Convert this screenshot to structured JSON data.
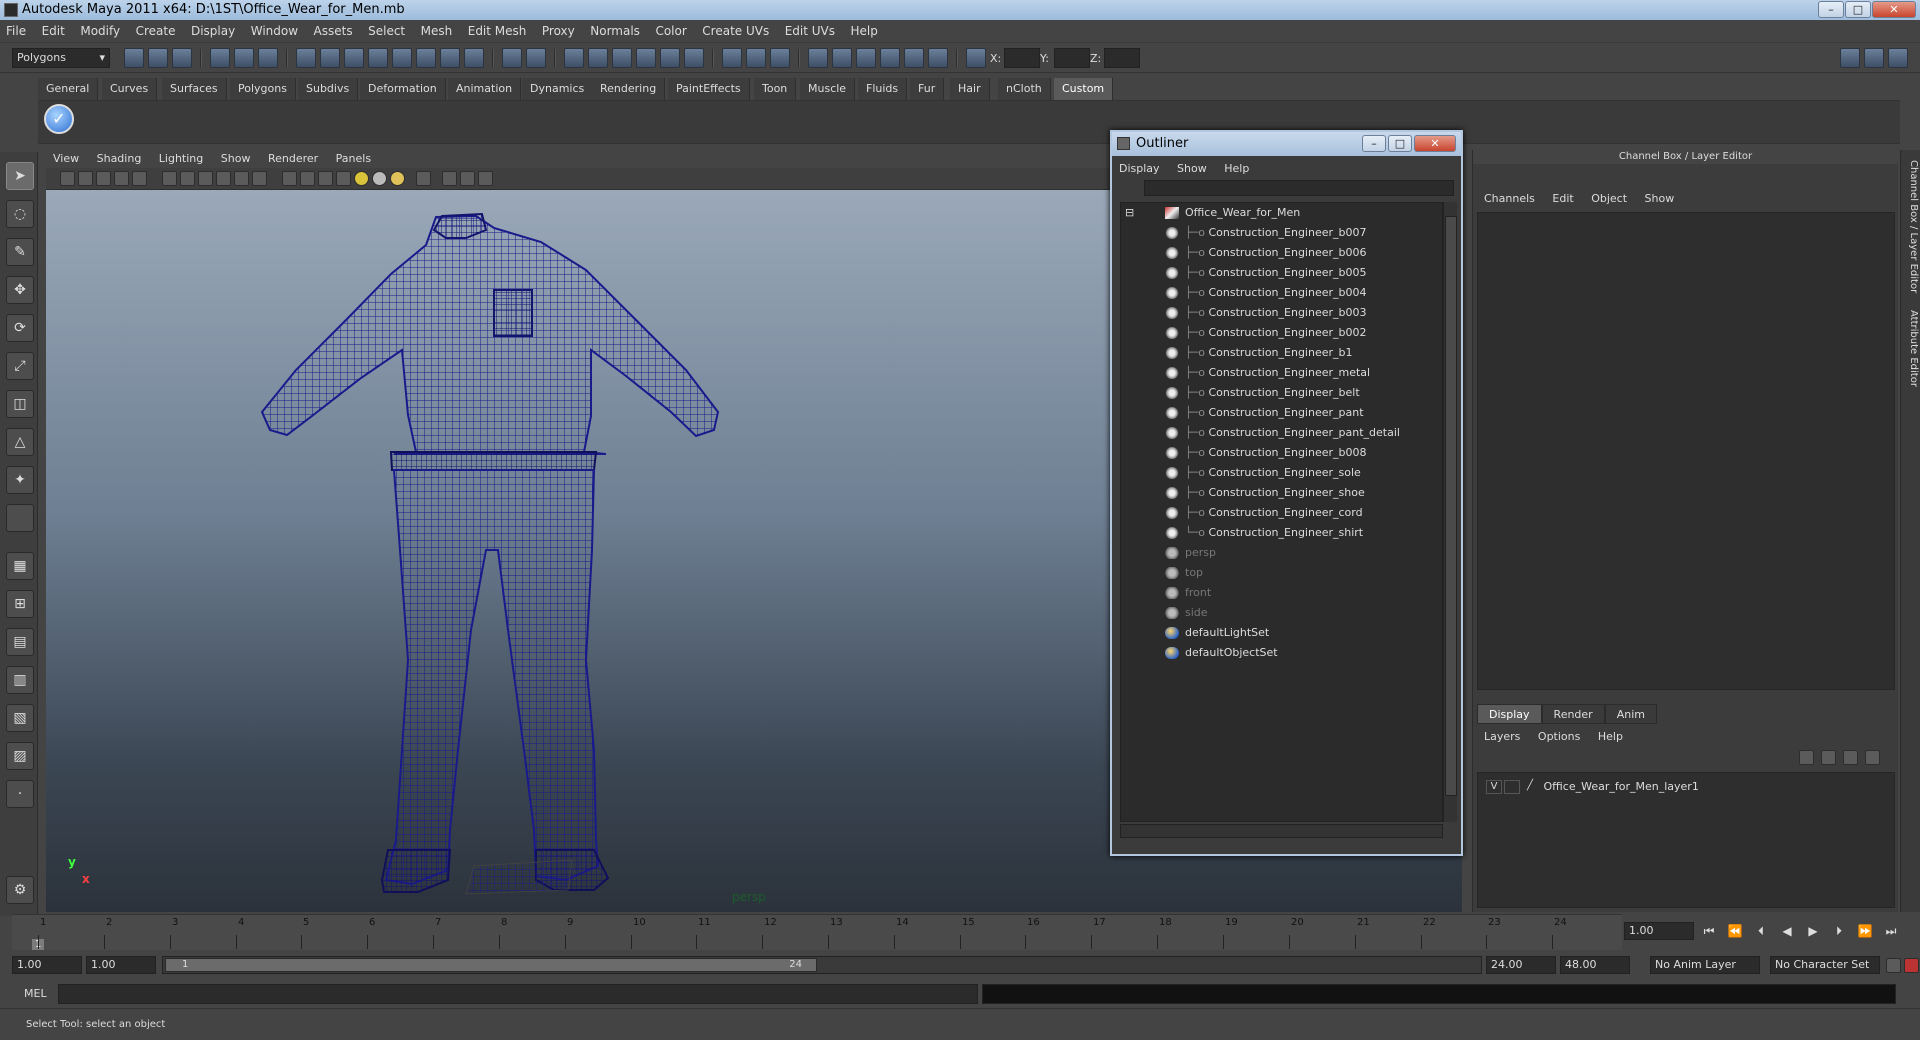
{
  "window": {
    "title": "Autodesk Maya 2011 x64: D:\\1ST\\Office_Wear_for_Men.mb",
    "minimize": "–",
    "maximize": "□",
    "close": "✕"
  },
  "menubar": [
    "File",
    "Edit",
    "Modify",
    "Create",
    "Display",
    "Window",
    "Assets",
    "Select",
    "Mesh",
    "Edit Mesh",
    "Proxy",
    "Normals",
    "Color",
    "Create UVs",
    "Edit UVs",
    "Help"
  ],
  "statusline": {
    "mode": "Polygons",
    "x_label": "X:",
    "y_label": "Y:",
    "z_label": "Z:"
  },
  "shelf_tabs": [
    "General",
    "Curves",
    "Surfaces",
    "Polygons",
    "Subdivs",
    "Deformation",
    "Animation",
    "Dynamics",
    "Rendering",
    "PaintEffects",
    "Toon",
    "Muscle",
    "Fluids",
    "Fur",
    "Hair",
    "nCloth",
    "Custom"
  ],
  "active_shelf_tab": "Custom",
  "viewport": {
    "menu": [
      "View",
      "Shading",
      "Lighting",
      "Show",
      "Renderer",
      "Panels"
    ],
    "camera_label": "persp",
    "axis_y": "y",
    "axis_x": "x",
    "wire_color": "#1a1a8c"
  },
  "outliner": {
    "title": "Outliner",
    "menu": [
      "Display",
      "Show",
      "Help"
    ],
    "root": "Office_Wear_for_Men",
    "children": [
      "Construction_Engineer_b007",
      "Construction_Engineer_b006",
      "Construction_Engineer_b005",
      "Construction_Engineer_b004",
      "Construction_Engineer_b003",
      "Construction_Engineer_b002",
      "Construction_Engineer_b1",
      "Construction_Engineer_metal",
      "Construction_Engineer_belt",
      "Construction_Engineer_pant",
      "Construction_Engineer_pant_detail",
      "Construction_Engineer_b008",
      "Construction_Engineer_sole",
      "Construction_Engineer_shoe",
      "Construction_Engineer_cord",
      "Construction_Engineer_shirt"
    ],
    "cameras": [
      "persp",
      "top",
      "front",
      "side"
    ],
    "sets": [
      "defaultLightSet",
      "defaultObjectSet"
    ]
  },
  "channel_box": {
    "title": "Channel Box / Layer Editor",
    "menu": [
      "Channels",
      "Edit",
      "Object",
      "Show"
    ],
    "tabs": [
      "Display",
      "Render",
      "Anim"
    ],
    "active_tab": "Display",
    "layer_menu": [
      "Layers",
      "Options",
      "Help"
    ],
    "layer": {
      "visible": "V",
      "name": "Office_Wear_for_Men_layer1"
    },
    "side_tabs": [
      "Channel Box / Layer Editor",
      "Attribute Editor"
    ]
  },
  "timeline": {
    "ticks": [
      "1",
      "2",
      "3",
      "4",
      "5",
      "6",
      "7",
      "8",
      "9",
      "10",
      "11",
      "12",
      "13",
      "14",
      "15",
      "16",
      "17",
      "18",
      "19",
      "20",
      "21",
      "22",
      "23",
      "24"
    ],
    "current_frame": "1",
    "current_field": "1.00"
  },
  "range": {
    "start": "1.00",
    "playback_start": "1.00",
    "handle_start": "1",
    "handle_end": "24",
    "playback_end": "24.00",
    "end": "48.00",
    "anim_layer": "No Anim Layer",
    "char_set": "No Character Set"
  },
  "command": {
    "label": "MEL"
  },
  "help": {
    "text": "Select Tool: select an object"
  }
}
